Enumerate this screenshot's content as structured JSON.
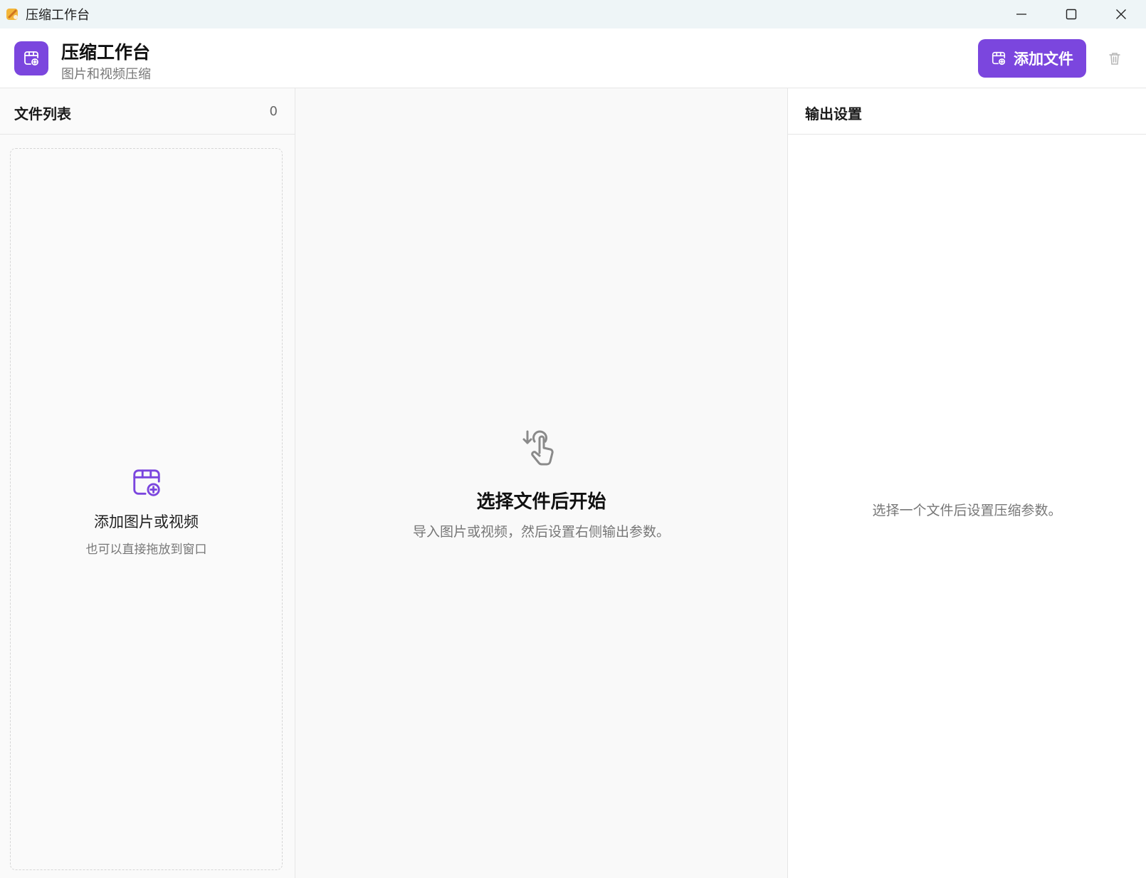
{
  "window": {
    "title": "压缩工作台",
    "controls": [
      "minimize-icon",
      "maximize-icon",
      "close-icon"
    ]
  },
  "header": {
    "title": "压缩工作台",
    "subtitle": "图片和视频压缩",
    "add_button_label": "添加文件",
    "accent_color": "#7b46de"
  },
  "file_list": {
    "title": "文件列表",
    "count": "0",
    "dropzone_title": "添加图片或视频",
    "dropzone_subtitle": "也可以直接拖放到窗口"
  },
  "main": {
    "empty_title": "选择文件后开始",
    "empty_subtitle": "导入图片或视频，然后设置右侧输出参数。"
  },
  "output_settings": {
    "title": "输出设置",
    "empty_text": "选择一个文件后设置压缩参数。"
  },
  "icons": {
    "brand": "media-add-icon",
    "add_button": "media-add-icon",
    "trash": "trash-icon",
    "center": "touch-drag-icon"
  }
}
